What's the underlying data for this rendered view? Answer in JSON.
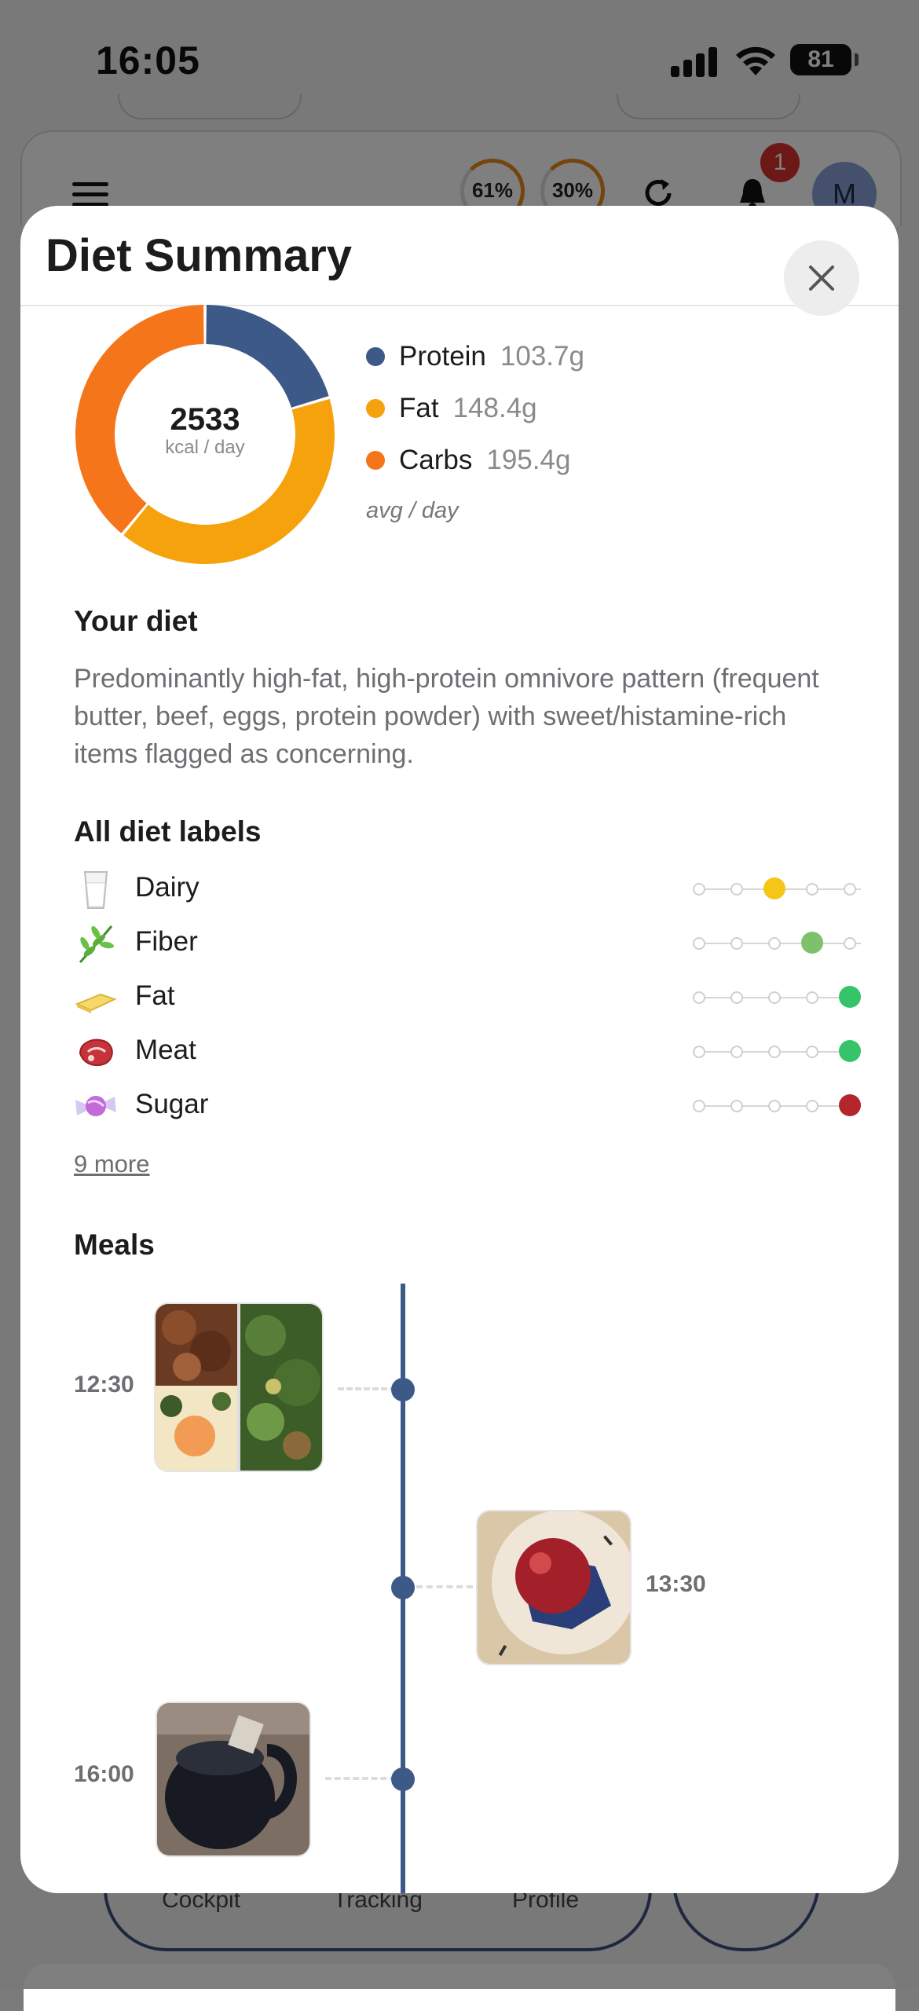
{
  "status_bar": {
    "time": "16:05",
    "battery": "81"
  },
  "background_app": {
    "ring_a": "61%",
    "ring_b": "30%",
    "notifications_badge": "1",
    "avatar_initial": "M",
    "tabs": [
      "Cockpit",
      "Tracking",
      "Profile"
    ]
  },
  "modal": {
    "title": "Diet Summary",
    "calories": {
      "value": "2533",
      "unit": "kcal / day"
    },
    "macros": [
      {
        "name": "Protein",
        "value": "103.7g",
        "color": "#3d5988",
        "fraction": 0.204
      },
      {
        "name": "Fat",
        "value": "148.4g",
        "color": "#f5a20c",
        "fraction": 0.406
      },
      {
        "name": "Carbs",
        "value": "195.4g",
        "color": "#f5761a",
        "fraction": 0.39
      }
    ],
    "macros_footnote": "avg / day",
    "your_diet": {
      "title": "Your diet",
      "description": "Predominantly high-fat, high-protein omnivore pattern (frequent butter, beef, eggs, protein powder) with sweet/histamine-rich items flagged as concerning."
    },
    "labels": {
      "title": "All diet labels",
      "items": [
        {
          "name": "Dairy",
          "icon": "milk-glass-icon",
          "level": 3,
          "color": "#f5c518"
        },
        {
          "name": "Fiber",
          "icon": "herb-icon",
          "level": 4,
          "color": "#7dc26b"
        },
        {
          "name": "Fat",
          "icon": "butter-icon",
          "level": 5,
          "color": "#35c46a"
        },
        {
          "name": "Meat",
          "icon": "meat-cut-icon",
          "level": 5,
          "color": "#35c46a"
        },
        {
          "name": "Sugar",
          "icon": "candy-icon",
          "level": 5,
          "color": "#b3262b"
        }
      ],
      "more": "9 more"
    },
    "meals": {
      "title": "Meals",
      "entries": [
        {
          "time": "12:30",
          "side": "left",
          "photo": "meat-eggs-and-greens-collage"
        },
        {
          "time": "13:30",
          "side": "right",
          "photo": "red-fruit-on-plate"
        },
        {
          "time": "16:00",
          "side": "left",
          "photo": "dark-mug"
        }
      ]
    }
  }
}
